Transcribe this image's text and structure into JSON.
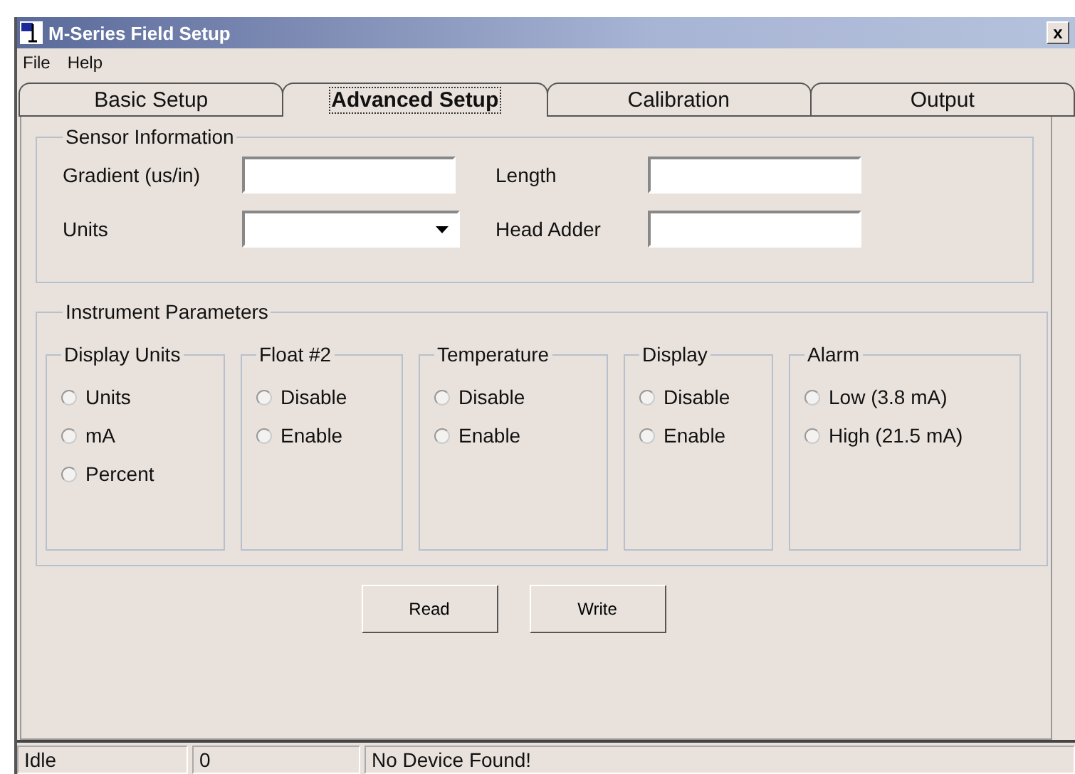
{
  "window": {
    "title": "M-Series Field Setup",
    "close": "x"
  },
  "menu": [
    "File",
    "Help"
  ],
  "tabs": [
    {
      "label": "Basic Setup",
      "selected": false
    },
    {
      "label": "Advanced Setup",
      "selected": true
    },
    {
      "label": "Calibration",
      "selected": false
    },
    {
      "label": "Output",
      "selected": false
    }
  ],
  "sensor_information": {
    "title": "Sensor Information",
    "fields": [
      {
        "label": "Gradient (us/in)",
        "kind": "text"
      },
      {
        "label": "Length",
        "kind": "text"
      },
      {
        "label": "Units",
        "kind": "dropdown"
      },
      {
        "label": "Head Adder",
        "kind": "text"
      }
    ]
  },
  "instrument_parameters": {
    "title": "Instrument Parameters",
    "groups": [
      {
        "title": "Display Units",
        "options": [
          {
            "label": "Units",
            "selected": false
          },
          {
            "label": "mA",
            "selected": false
          },
          {
            "label": "Percent",
            "selected": false
          }
        ]
      },
      {
        "title": "Float #2",
        "options": [
          {
            "label": "Disable",
            "selected": false
          },
          {
            "label": "Enable",
            "selected": false
          }
        ]
      },
      {
        "title": "Temperature",
        "options": [
          {
            "label": "Disable",
            "selected": false
          },
          {
            "label": "Enable",
            "selected": false
          }
        ]
      },
      {
        "title": "Display",
        "options": [
          {
            "label": "Disable",
            "selected": false
          },
          {
            "label": "Enable",
            "selected": false
          }
        ]
      },
      {
        "title": "Alarm",
        "options": [
          {
            "label": "Low (3.8 mA)",
            "selected": false
          },
          {
            "label": "High (21.5 mA)",
            "selected": false
          }
        ]
      }
    ]
  },
  "buttons": [
    "Read",
    "Write"
  ],
  "status_bar": [
    "Idle",
    "0",
    "No Device Found!"
  ]
}
